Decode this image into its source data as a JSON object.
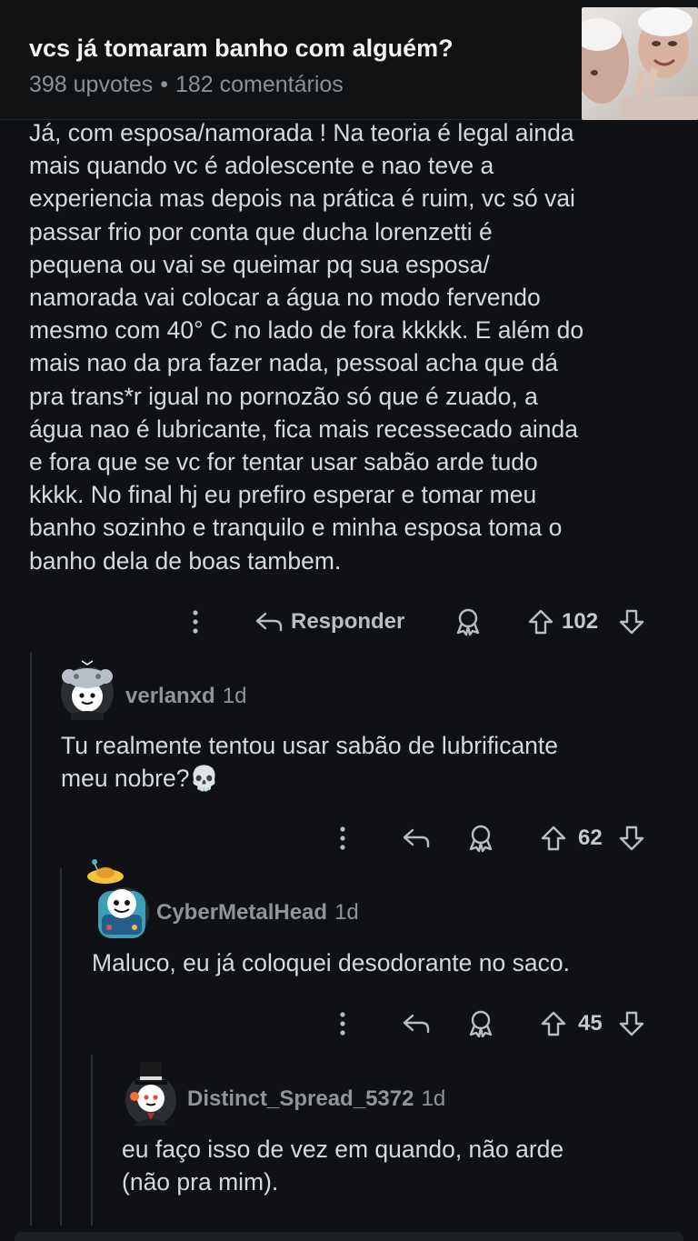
{
  "post": {
    "title": "vcs já tomaram banho com alguém?",
    "upvotes": "398 upvotes",
    "separator": "•",
    "comments": "182 comentários"
  },
  "top_comment": {
    "text": "Já, com esposa/namorada ! Na teoria é legal ainda\nmais quando vc é adolescente e nao teve a\nexperiencia mas depois na prática é ruim, vc só vai\npassar frio por conta que ducha lorenzetti é\npequena ou vai se queimar pq sua esposa/\nnamorada vai colocar a água no modo fervendo\nmesmo com 40° C no lado de fora kkkkk. E além do\nmais nao da pra fazer nada, pessoal acha que dá\npra trans*r igual no pornozão só que é zuado, a\nágua nao é lubricante, fica mais recessecado ainda\ne fora que se vc for tentar usar sabão arde tudo\nkkkk. No final hj eu prefiro esperar e tomar meu\nbanho sozinho e tranquilo e minha esposa toma o\nbanho dela de boas tambem.",
    "reply_label": "Responder",
    "score": "102"
  },
  "replies": [
    {
      "username": "verlanxd",
      "age": "1d",
      "text": "Tu realmente tentou usar sabão de lubrificante\nmeu nobre?💀",
      "score": "62"
    },
    {
      "username": "CyberMetalHead",
      "age": "1d",
      "text": "Maluco, eu já coloquei desodorante no saco.",
      "score": "45"
    },
    {
      "username": "Distinct_Spread_5372",
      "age": "1d",
      "text": "eu faço isso de vez em quando, não arde\n(não pra mim)."
    }
  ],
  "icons": {
    "more": "more-vertical-icon",
    "reply": "reply-arrow-icon",
    "award": "award-icon",
    "upvote": "upvote-icon",
    "downvote": "downvote-icon"
  },
  "colors": {
    "background": "#0f1114",
    "text": "#d7dadc",
    "muted": "#8e959b",
    "thread_line": "#2c3035"
  }
}
